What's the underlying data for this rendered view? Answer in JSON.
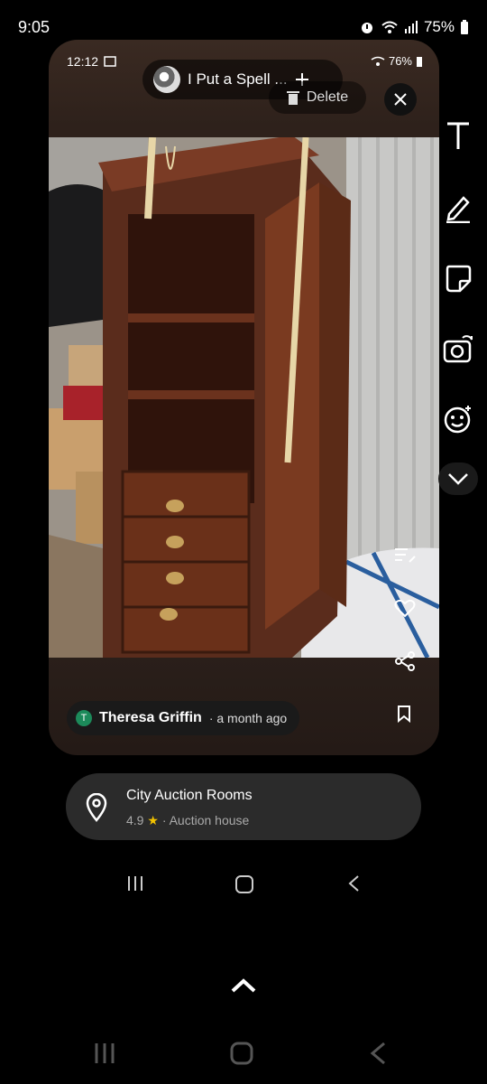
{
  "outer_status": {
    "time": "9:05",
    "battery": "75%"
  },
  "inner_status": {
    "time": "12:12",
    "battery": "76%"
  },
  "music": {
    "title": "I Put a Spell ..."
  },
  "delete_label": "Delete",
  "post": {
    "author_initial": "T",
    "author": "Theresa Griffin",
    "time_ago": "· a month ago"
  },
  "toolbar": {
    "icons": [
      "text-icon",
      "pen-icon",
      "sticker-icon",
      "camera-flip-icon",
      "emoji-icon",
      "chevron-down-icon"
    ],
    "side_icons": [
      "edit-list-icon",
      "heart-icon",
      "share-icon"
    ]
  },
  "location": {
    "name": "City Auction Rooms",
    "rating": "4.9",
    "star": "★",
    "category": "· Auction house"
  }
}
